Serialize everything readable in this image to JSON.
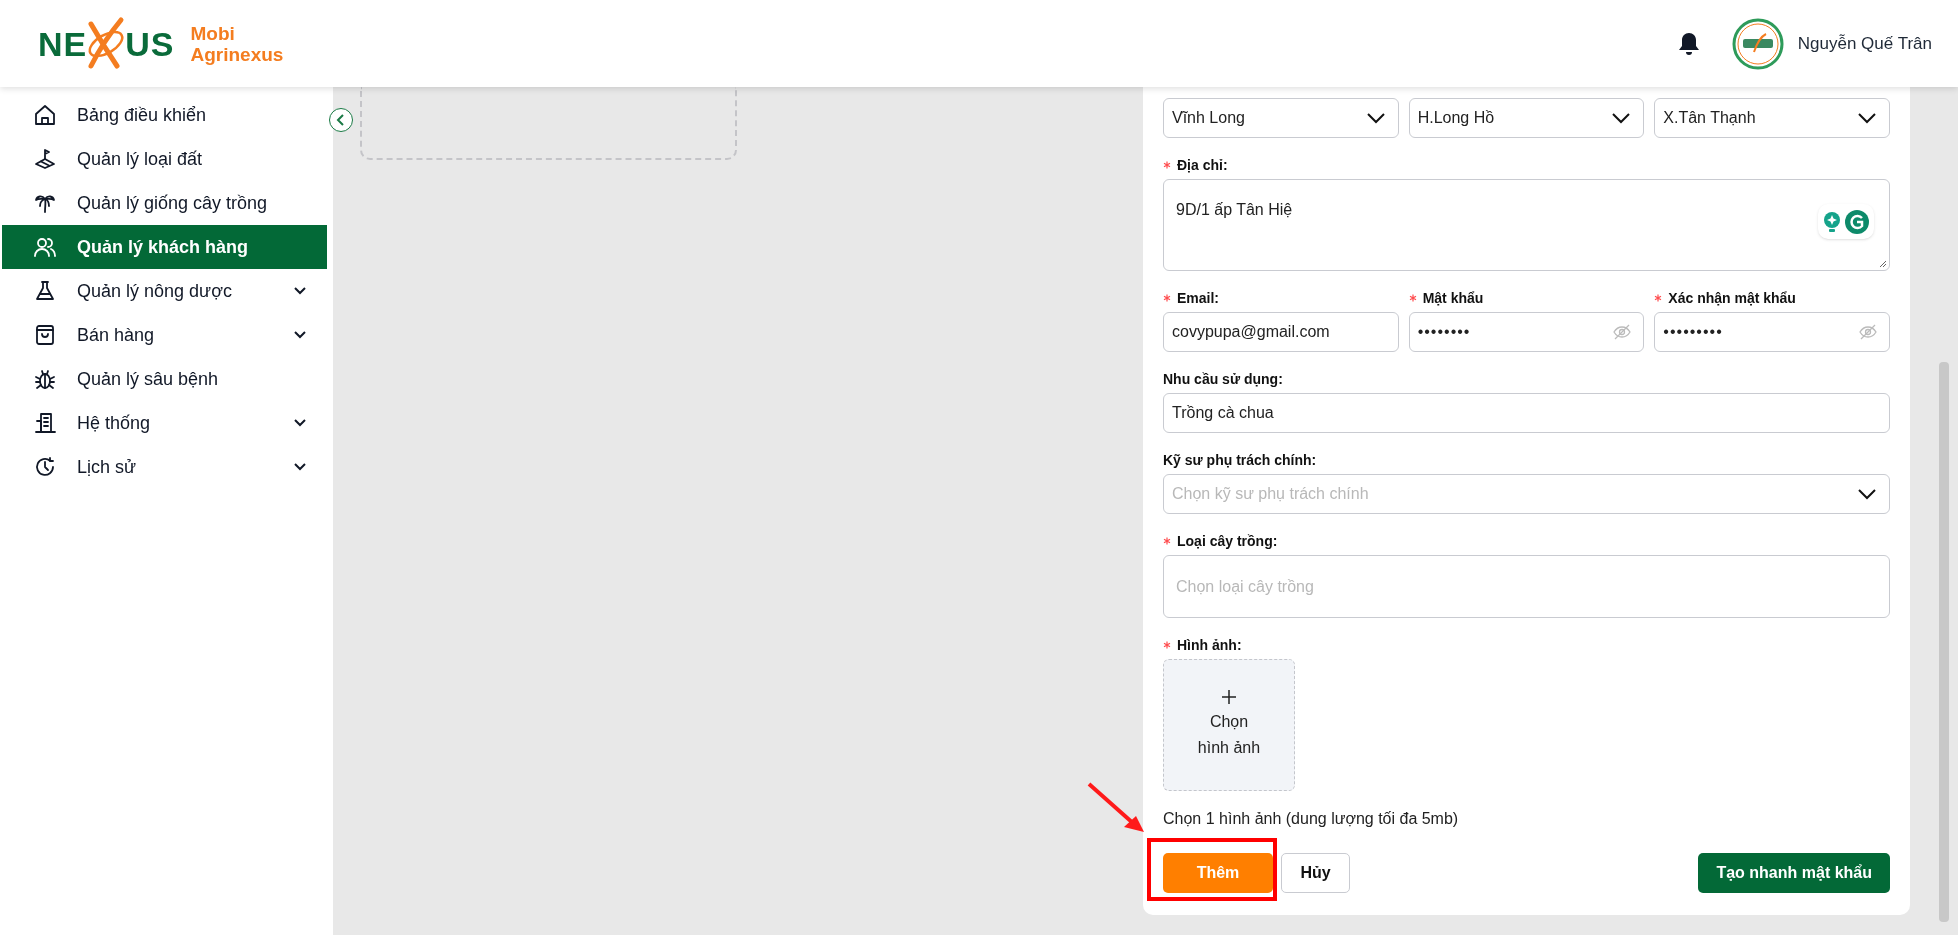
{
  "header": {
    "logo": {
      "mark_left": "NE",
      "mark_right": "US",
      "line1": "Mobi",
      "line2": "Agrinexus"
    },
    "user_name": "Nguyễn Quế Trân"
  },
  "sidebar": {
    "items": [
      {
        "label": "Bảng điều khiển",
        "selected": false,
        "expandable": false
      },
      {
        "label": "Quản lý loại đất",
        "selected": false,
        "expandable": false
      },
      {
        "label": "Quản lý giống cây trồng",
        "selected": false,
        "expandable": false
      },
      {
        "label": "Quản lý khách hàng",
        "selected": true,
        "expandable": false
      },
      {
        "label": "Quản lý nông dược",
        "selected": false,
        "expandable": true
      },
      {
        "label": "Bán hàng",
        "selected": false,
        "expandable": true
      },
      {
        "label": "Quản lý sâu bệnh",
        "selected": false,
        "expandable": false
      },
      {
        "label": "Hệ thống",
        "selected": false,
        "expandable": true
      },
      {
        "label": "Lịch sử",
        "selected": false,
        "expandable": true
      }
    ]
  },
  "form": {
    "rows": [
      {
        "fields": [
          {
            "kind": "select",
            "value": "Vĩnh Long"
          },
          {
            "kind": "select",
            "value": "H.Long Hồ"
          },
          {
            "kind": "select",
            "value": "X.Tân Thạnh"
          }
        ]
      },
      {
        "fields": [
          {
            "kind": "textarea",
            "label": "Địa chỉ:",
            "required": true,
            "value": "9D/1 ấp Tân Hiệ"
          }
        ]
      },
      {
        "fields": [
          {
            "kind": "text",
            "label": "Email:",
            "required": true,
            "value": "covypupa@gmail.com"
          },
          {
            "kind": "password",
            "label": "Mật khẩu",
            "required": true,
            "value": "••••••••"
          },
          {
            "kind": "password",
            "label": "Xác nhận mật khẩu",
            "required": true,
            "value": "•••••••••"
          }
        ]
      },
      {
        "fields": [
          {
            "kind": "text",
            "label": "Nhu cầu sử dụng:",
            "required": false,
            "value": "Trồng cà chua"
          }
        ]
      },
      {
        "fields": [
          {
            "kind": "select",
            "label": "Kỹ sư phụ trách chính:",
            "required": false,
            "placeholder": "Chọn kỹ sư phụ trách chính"
          }
        ]
      },
      {
        "fields": [
          {
            "kind": "multiselect",
            "label": "Loại cây trồng:",
            "required": true,
            "placeholder": "Chọn loại cây trồng"
          }
        ]
      },
      {
        "fields": [
          {
            "kind": "upload",
            "label": "Hình ảnh:",
            "required": true,
            "button_text": "Chọn hình ảnh",
            "hint": "Chọn 1 hình ảnh (dung lượng tối đa 5mb)"
          }
        ]
      }
    ],
    "buttons": [
      {
        "kind": "primary",
        "label": "Thêm"
      },
      {
        "kind": "secondary",
        "label": "Hủy"
      },
      {
        "kind": "success",
        "label": "Tạo nhanh mật khẩu"
      }
    ]
  }
}
